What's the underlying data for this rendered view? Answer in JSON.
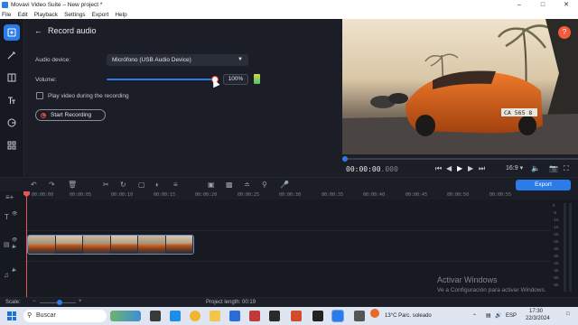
{
  "window": {
    "title": "Movavi Video Suite – New project *",
    "controls": [
      "–",
      "□",
      "✕"
    ]
  },
  "menu": [
    "File",
    "Edit",
    "Playback",
    "Settings",
    "Export",
    "Help"
  ],
  "record_panel": {
    "title": "Record audio",
    "device_label": "Audio device:",
    "device_value": "Micrófono (USB Audio Device)",
    "volume_label": "Volume:",
    "volume_value": "100%",
    "volume_fraction": 1.0,
    "play_video_label": "Play video during the recording",
    "play_video_checked": false,
    "start_button": "Start Recording"
  },
  "preview": {
    "help": "?",
    "plate_text": "CA 565 8",
    "timecode_main": "00:00:00",
    "timecode_frac": ".000",
    "aspect": "16:9",
    "position_fraction": 0.0
  },
  "timeline": {
    "export_label": "Export",
    "ruler": [
      "00:00:00",
      "00:00:05",
      "00:00:10",
      "00:00:15",
      "00:00:20",
      "00:00:25",
      "00:00:30",
      "00:00:35",
      "00:00:40",
      "00:00:45",
      "00:00:50",
      "00:00:55"
    ],
    "meter_ticks": [
      "0",
      "-5",
      "-10",
      "-15",
      "-20",
      "-25",
      "-30",
      "-35",
      "-40",
      "-45",
      "-50",
      "-55"
    ],
    "clip_thumbnails": 6
  },
  "status": {
    "scale_label": "Scale:",
    "scale_fraction": 0.55,
    "project_length_label": "Project length:",
    "project_length_value": "00:19"
  },
  "watermark": {
    "line1": "Activar Windows",
    "line2": "Ve a Configuración para activar Windows."
  },
  "taskbar": {
    "search_placeholder": "Buscar",
    "weather": "13°C  Parc. soleado",
    "lang": "ESP",
    "time": "17:30",
    "date": "22/3/2024"
  },
  "colors": {
    "accent": "#2b7be9",
    "record": "#e54646",
    "help": "#f15b3b",
    "background": "#1b1e26"
  }
}
